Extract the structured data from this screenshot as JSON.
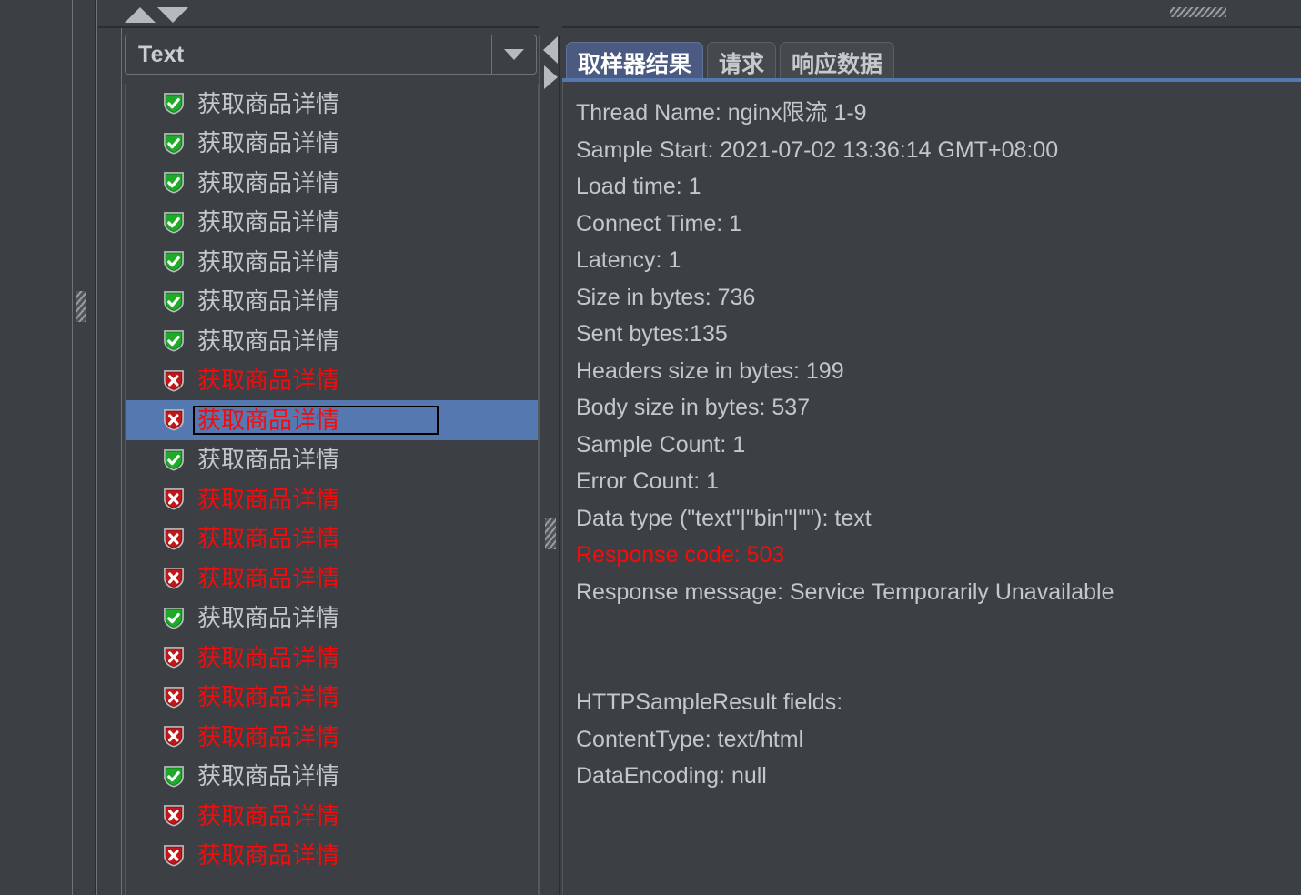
{
  "window": {
    "theme": "dark",
    "bg_color": "#3c4044",
    "accent_color": "#5578b0",
    "error_color": "#f40c0c",
    "success_color": "#1faa2a"
  },
  "toolbar": {
    "sort_up_icon": "triangle-up-icon",
    "sort_down_icon": "triangle-down-icon",
    "sort_up_label": "",
    "sort_down_label": ""
  },
  "renderer_combo": {
    "selected": "Text",
    "arrow_icon": "chevron-down-icon",
    "options": [
      "Text"
    ]
  },
  "splitters": {
    "collapse_left_icon": "triangle-left-icon",
    "collapse_right_icon": "triangle-right-icon",
    "grip_icon": "splitter-grip-icon"
  },
  "tree": {
    "rows": [
      {
        "label": "获取商品详情",
        "status": "success",
        "icon": "shield-check-icon",
        "selected": false
      },
      {
        "label": "获取商品详情",
        "status": "success",
        "icon": "shield-check-icon",
        "selected": false
      },
      {
        "label": "获取商品详情",
        "status": "success",
        "icon": "shield-check-icon",
        "selected": false
      },
      {
        "label": "获取商品详情",
        "status": "success",
        "icon": "shield-check-icon",
        "selected": false
      },
      {
        "label": "获取商品详情",
        "status": "success",
        "icon": "shield-check-icon",
        "selected": false
      },
      {
        "label": "获取商品详情",
        "status": "success",
        "icon": "shield-check-icon",
        "selected": false
      },
      {
        "label": "获取商品详情",
        "status": "success",
        "icon": "shield-check-icon",
        "selected": false
      },
      {
        "label": "获取商品详情",
        "status": "error",
        "icon": "shield-x-icon",
        "selected": false
      },
      {
        "label": "获取商品详情",
        "status": "error",
        "icon": "shield-x-icon",
        "selected": true
      },
      {
        "label": "获取商品详情",
        "status": "success",
        "icon": "shield-check-icon",
        "selected": false
      },
      {
        "label": "获取商品详情",
        "status": "error",
        "icon": "shield-x-icon",
        "selected": false
      },
      {
        "label": "获取商品详情",
        "status": "error",
        "icon": "shield-x-icon",
        "selected": false
      },
      {
        "label": "获取商品详情",
        "status": "error",
        "icon": "shield-x-icon",
        "selected": false
      },
      {
        "label": "获取商品详情",
        "status": "success",
        "icon": "shield-check-icon",
        "selected": false
      },
      {
        "label": "获取商品详情",
        "status": "error",
        "icon": "shield-x-icon",
        "selected": false
      },
      {
        "label": "获取商品详情",
        "status": "error",
        "icon": "shield-x-icon",
        "selected": false
      },
      {
        "label": "获取商品详情",
        "status": "error",
        "icon": "shield-x-icon",
        "selected": false
      },
      {
        "label": "获取商品详情",
        "status": "success",
        "icon": "shield-check-icon",
        "selected": false
      },
      {
        "label": "获取商品详情",
        "status": "error",
        "icon": "shield-x-icon",
        "selected": false
      },
      {
        "label": "获取商品详情",
        "status": "error",
        "icon": "shield-x-icon",
        "selected": false
      }
    ]
  },
  "detail": {
    "tabs": [
      {
        "label": "取样器结果",
        "active": true
      },
      {
        "label": "请求",
        "active": false
      },
      {
        "label": "响应数据",
        "active": false
      }
    ],
    "result_lines": [
      {
        "text": "Thread Name: nginx限流 1-9",
        "style": "normal"
      },
      {
        "text": "Sample Start: 2021-07-02 13:36:14 GMT+08:00",
        "style": "normal"
      },
      {
        "text": "Load time: 1",
        "style": "normal"
      },
      {
        "text": "Connect Time: 1",
        "style": "normal"
      },
      {
        "text": "Latency: 1",
        "style": "normal"
      },
      {
        "text": "Size in bytes: 736",
        "style": "normal"
      },
      {
        "text": "Sent bytes:135",
        "style": "normal"
      },
      {
        "text": "Headers size in bytes: 199",
        "style": "normal"
      },
      {
        "text": "Body size in bytes: 537",
        "style": "normal"
      },
      {
        "text": "Sample Count: 1",
        "style": "normal"
      },
      {
        "text": "Error Count: 1",
        "style": "normal"
      },
      {
        "text": "Data type (\"text\"|\"bin\"|\"\"): text",
        "style": "normal"
      },
      {
        "text": "Response code: 503",
        "style": "error"
      },
      {
        "text": "Response message: Service Temporarily Unavailable",
        "style": "normal"
      },
      {
        "text": " ",
        "style": "blank"
      },
      {
        "text": " ",
        "style": "blank"
      },
      {
        "text": "HTTPSampleResult fields:",
        "style": "normal"
      },
      {
        "text": "ContentType: text/html",
        "style": "normal"
      },
      {
        "text": "DataEncoding: null",
        "style": "normal"
      }
    ]
  }
}
